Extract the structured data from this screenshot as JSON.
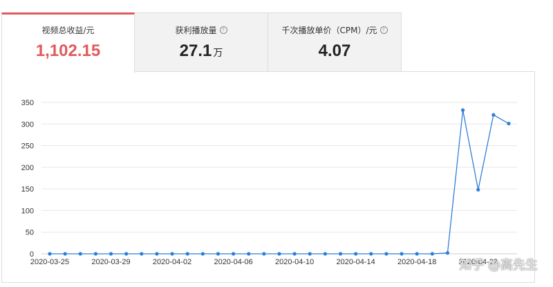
{
  "tabs": [
    {
      "label": "视频总收益/元",
      "value": "1,102.15",
      "unit": "",
      "info": false,
      "active": true
    },
    {
      "label": "获利播放量",
      "value": "27.1",
      "unit": "万",
      "info": true,
      "active": false
    },
    {
      "label": "千次播放单价（CPM）/元",
      "value": "4.07",
      "unit": "",
      "info": true,
      "active": false
    }
  ],
  "colors": {
    "accent": "#e2595b",
    "line": "#2f7ed8",
    "grid": "#e6e6e6"
  },
  "watermark": "知乎 @高先生",
  "chart_data": {
    "type": "line",
    "title": "",
    "xlabel": "",
    "ylabel": "",
    "ylim": [
      0,
      350
    ],
    "yticks": [
      0,
      50,
      100,
      150,
      200,
      250,
      300,
      350
    ],
    "grid": true,
    "xtick_labels": [
      "2020-03-25",
      "2020-03-29",
      "2020-04-02",
      "2020-04-06",
      "2020-04-10",
      "2020-04-14",
      "2020-04-18",
      "2020-04-22"
    ],
    "x": [
      "2020-03-25",
      "2020-03-26",
      "2020-03-27",
      "2020-03-28",
      "2020-03-29",
      "2020-03-30",
      "2020-03-31",
      "2020-04-01",
      "2020-04-02",
      "2020-04-03",
      "2020-04-04",
      "2020-04-05",
      "2020-04-06",
      "2020-04-07",
      "2020-04-08",
      "2020-04-09",
      "2020-04-10",
      "2020-04-11",
      "2020-04-12",
      "2020-04-13",
      "2020-04-14",
      "2020-04-15",
      "2020-04-16",
      "2020-04-17",
      "2020-04-18",
      "2020-04-19",
      "2020-04-20",
      "2020-04-21",
      "2020-04-22",
      "2020-04-23",
      "2020-04-24"
    ],
    "series": [
      {
        "values": [
          0,
          0,
          0,
          0,
          0,
          0,
          0,
          0,
          0,
          0,
          0,
          0,
          0,
          0,
          0,
          0,
          0,
          0,
          0,
          0,
          0,
          0,
          0,
          0,
          0,
          0,
          2,
          332,
          148,
          321,
          301
        ]
      }
    ]
  }
}
